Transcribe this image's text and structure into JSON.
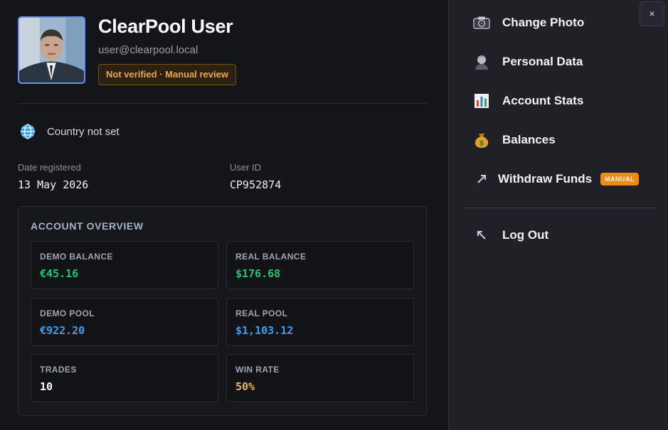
{
  "profile": {
    "name": "ClearPool User",
    "email": "user@clearpool.local",
    "verification_badge": "Not verified · Manual review",
    "country": "Country not set",
    "date_registered_label": "Date registered",
    "date_registered_value": "13 May 2026",
    "user_id_label": "User ID",
    "user_id_value": "CP952874"
  },
  "overview": {
    "title": "ACCOUNT OVERVIEW",
    "cards": [
      {
        "label": "DEMO BALANCE",
        "value": "€45.16",
        "color": "#1fc56e"
      },
      {
        "label": "REAL BALANCE",
        "value": "$176.68",
        "color": "#1fc56e"
      },
      {
        "label": "DEMO POOL",
        "value": "€922.20",
        "color": "#3b9cf0"
      },
      {
        "label": "REAL POOL",
        "value": "$1,103.12",
        "color": "#3b9cf0"
      },
      {
        "label": "TRADES",
        "value": "10",
        "color": "#ffffff"
      },
      {
        "label": "WIN RATE",
        "value": "50%",
        "color": "#f2b24a"
      }
    ]
  },
  "menu": {
    "close_label": "×",
    "items": [
      {
        "label": "Change Photo",
        "icon": "camera-icon"
      },
      {
        "label": "Personal Data",
        "icon": "person-icon"
      },
      {
        "label": "Account Stats",
        "icon": "bar-chart-icon"
      },
      {
        "label": "Balances",
        "icon": "money-bag-icon"
      },
      {
        "label": "Withdraw Funds",
        "icon": "arrow-up-right-icon",
        "badge": "MANUAL"
      },
      {
        "label": "Log Out",
        "icon": "arrow-up-left-icon"
      }
    ]
  },
  "colors": {
    "accent_border": "#6c8cff",
    "badge_orange": "#f08a12",
    "warning_text": "#f0a83a"
  }
}
